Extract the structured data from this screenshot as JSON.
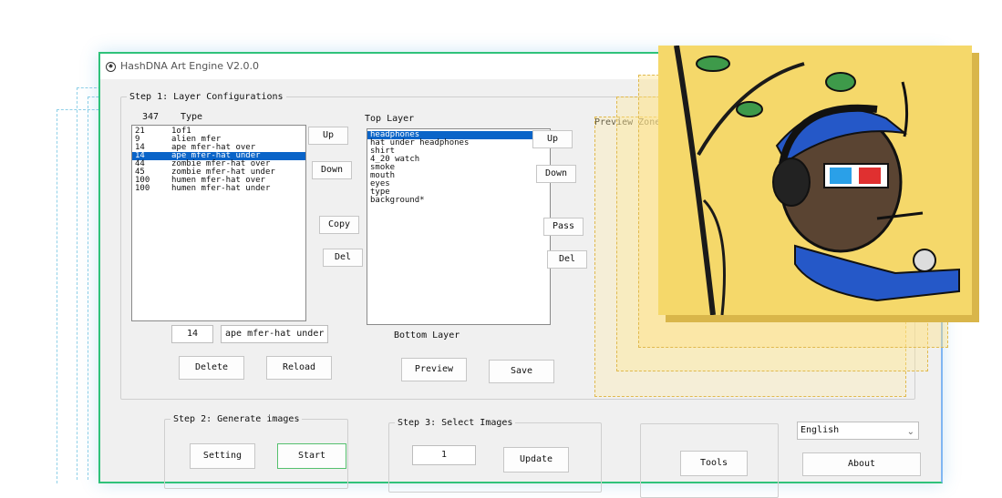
{
  "app": {
    "title": "HashDNA Art Engine V2.0.0"
  },
  "step1": {
    "legend": "Step 1: Layer Configurations",
    "count": "347",
    "type_header": "Type",
    "types": [
      {
        "num": "21",
        "name": "1of1"
      },
      {
        "num": "9",
        "name": "alien mfer"
      },
      {
        "num": "14",
        "name": "ape mfer-hat over"
      },
      {
        "num": "14",
        "name": "ape mfer-hat under"
      },
      {
        "num": "44",
        "name": "zombie mfer-hat over"
      },
      {
        "num": "45",
        "name": "zombie mfer-hat under"
      },
      {
        "num": "100",
        "name": "humen mfer-hat over"
      },
      {
        "num": "100",
        "name": "humen mfer-hat under"
      }
    ],
    "selected_type_index": 3,
    "buttons": {
      "up": "Up",
      "down": "Down",
      "copy": "Copy",
      "del": "Del"
    },
    "edit_num": "14",
    "edit_name": "ape mfer-hat under",
    "delete": "Delete",
    "reload": "Reload",
    "top_layer_label": "Top Layer",
    "layers": [
      "headphones",
      "hat under headphones",
      "shirt",
      "4_20 watch",
      "smoke",
      "mouth",
      "eyes",
      "type",
      "background*"
    ],
    "selected_layer_index": 0,
    "layer_buttons": {
      "up": "Up",
      "down": "Down",
      "pass": "Pass",
      "del": "Del"
    },
    "bottom_layer_label": "Bottom Layer",
    "preview": "Preview",
    "save": "Save",
    "preview_zone": "Preview Zone"
  },
  "step2": {
    "legend": "Step 2: Generate images",
    "setting": "Setting",
    "start": "Start"
  },
  "step3": {
    "legend": "Step 3: Select Images",
    "value": "1",
    "update": "Update"
  },
  "tools": "Tools",
  "language": {
    "selected": "English"
  },
  "about": "About",
  "colors": {
    "accent": "#0a64c8",
    "frame": "#2fc27a",
    "art_bg": "#f5d86a"
  }
}
